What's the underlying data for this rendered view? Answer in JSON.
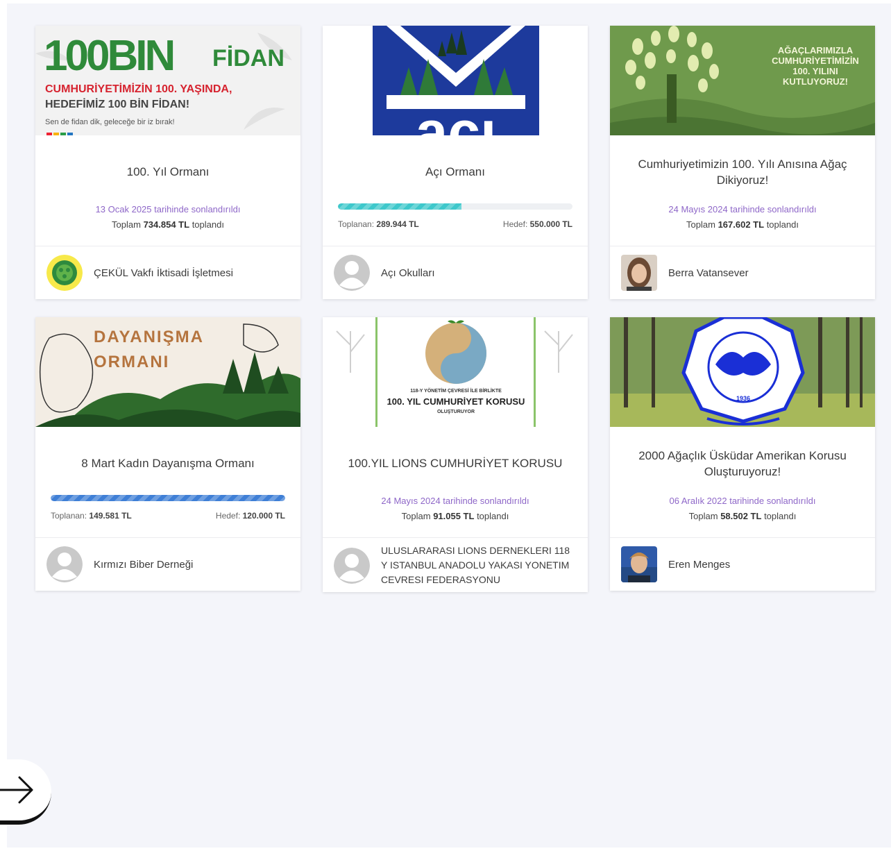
{
  "cards": [
    {
      "banner": {
        "big": "100BIN",
        "fidan": "FİDAN",
        "line1": "CUMHURİYETİMİZİN 100. YAŞINDA,",
        "line2": "HEDEFİMİZ 100 BİN FİDAN!",
        "line3": "Sen de fidan dik, geleceğe bir iz bırak!"
      },
      "title": "100. Yıl Ormanı",
      "ended": "13 Ocak 2025 tarihinde sonlandırıldı",
      "total_pre": "Toplam ",
      "total_amount": "734.854 TL",
      "total_post": " toplandı",
      "organizer": "ÇEKÜL Vakfı İktisadi İşletmesi"
    },
    {
      "banner": {
        "text": "açı"
      },
      "title": "Açı Ormanı",
      "progress": 0.527,
      "progress_color": "#3ec8cb",
      "collected_label": "Toplanan: ",
      "collected": "289.944 TL",
      "target_label": "Hedef: ",
      "target": "550.000 TL",
      "organizer": "Açı Okulları"
    },
    {
      "banner": {
        "line1": "AĞAÇLARIMIZLA",
        "line2": "CUMHURİYETİMİZİN",
        "line3": "100. YILINI",
        "line4": "KUTLUYORUZ!"
      },
      "title": "Cumhuriyetimizin 100. Yılı Anısına Ağaç Dikiyoruz!",
      "ended": "24 Mayıs 2024 tarihinde sonlandırıldı",
      "total_pre": "Toplam ",
      "total_amount": "167.602 TL",
      "total_post": " toplandı",
      "organizer": "Berra Vatansever"
    },
    {
      "banner": {
        "line1": "DAYANIŞMA",
        "line2": "ORMANI"
      },
      "title": "8 Mart Kadın Dayanışma Ormanı",
      "progress": 1.0,
      "progress_color": "#3f7fd6",
      "collected_label": "Toplanan: ",
      "collected": "149.581 TL",
      "target_label": "Hedef: ",
      "target": "120.000 TL",
      "organizer": "Kırmızı Biber Derneği"
    },
    {
      "banner": {
        "small": "118-Y YÖNETİM ÇEVRESİ İLE BİRLİKTE",
        "main": "100. YIL CUMHURİYET KORUSU",
        "sub": "OLUŞTURUYOR"
      },
      "title": "100.YIL LIONS CUMHURİYET KORUSU",
      "ended": "24 Mayıs 2024 tarihinde sonlandırıldı",
      "total_pre": "Toplam ",
      "total_amount": "91.055 TL",
      "total_post": " toplandı",
      "organizer": "ULUSLARARASI LIONS DERNEKLERI 118 Y ISTANBUL ANADOLU YAKASI YONETIM CEVRESI FEDERASYONU"
    },
    {
      "banner": {
        "ring_top": "AMERICAN ACADEMY",
        "ring_bottom": "STUDENT ASSOCIATION",
        "year": "1936"
      },
      "title": "2000 Ağaçlık Üsküdar Amerikan Korusu Oluşturuyoruz!",
      "ended": "06 Aralık 2022 tarihinde sonlandırıldı",
      "total_pre": "Toplam ",
      "total_amount": "58.502 TL",
      "total_post": " toplandı",
      "organizer": "Eren Menges"
    }
  ],
  "icons": {
    "next": "arrow-right-icon",
    "placeholder_avatar": "user-placeholder-icon"
  }
}
